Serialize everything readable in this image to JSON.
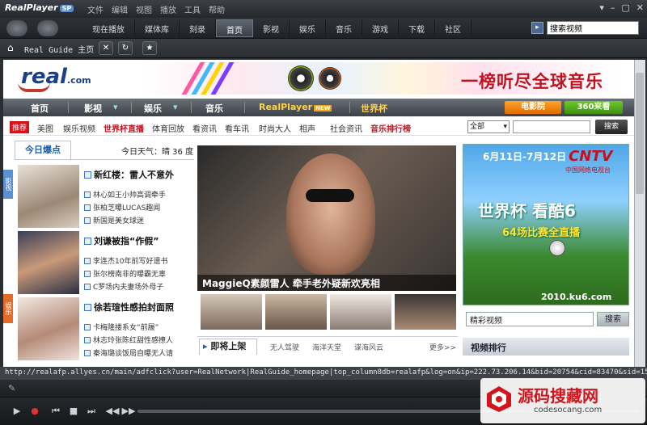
{
  "titlebar": {
    "logo": "RealPlayer",
    "logo_badge": "SP",
    "menu": [
      "文件",
      "编辑",
      "视图",
      "播放",
      "工具",
      "帮助"
    ],
    "window_buttons": [
      "▾",
      "–",
      "▢",
      "✕"
    ]
  },
  "nav": {
    "tabs": [
      "现在播放",
      "媒体库",
      "刻录",
      "首页",
      "影视",
      "娱乐",
      "音乐",
      "游戏",
      "下载",
      "社区"
    ],
    "active_tab": "首页",
    "search_value": "搜索视频"
  },
  "address": {
    "text": "Real Guide 主页",
    "buttons": [
      "✕",
      "↻",
      "★"
    ]
  },
  "site": {
    "logo": "real",
    "logo_suffix": ".com",
    "banner_text": "一榜听尽全球音乐",
    "channels": [
      "首页",
      "影视",
      "娱乐",
      "音乐",
      "RealPlayer",
      "世界杯"
    ],
    "realplayer_badge": "NEW",
    "btn_movie": "电影院",
    "btn_360": "360来看",
    "hot_badge": "推荐",
    "subnav": [
      "美图",
      "娱乐视频",
      "世界杯直播",
      "体育回放",
      "看资讯",
      "看车讯",
      "时尚大人",
      "相声",
      "社会资讯",
      "音乐排行榜"
    ],
    "subnav_select": "全部",
    "subnav_search_btn": "搜索",
    "today_tab": "今日爆点",
    "weather": "今日天气：晴 36 度",
    "side_tab_1": "影视",
    "side_tab_2": "娱乐",
    "news": [
      {
        "headline": "新红楼：雷人不意外",
        "links": [
          "林心如王小帅高调牵手",
          "张柏芝曝LUCAS趣闻",
          "新国是美女球迷"
        ]
      },
      {
        "headline": "刘谦被指“作假”",
        "links": [
          "李连杰10年前写好遗书",
          "张尔榜南非的曝霸无辜",
          "C罗场内夫妻场外母子"
        ]
      },
      {
        "headline": "徐若瑄性感拍封面照",
        "links": [
          "卡梅隆搂系女“前履”",
          "林志玲张陈红甜性感撩人",
          "秦海璐谈饭局自曝无人请"
        ]
      }
    ],
    "feature_caption": "MaggieQ素颜雷人 牵手老外疑新欢亮相",
    "upcoming_tab": "即将上架",
    "upcoming_links": [
      "无人驾驶",
      "海洋天堂",
      "谍海风云"
    ],
    "upcoming_more": "更多>>",
    "ad": {
      "dates": "6月11日-7月12日",
      "brand": "CNTV",
      "brand_sub": "中国网络电视台",
      "slogan": "世界杯 看酷6",
      "slogan2": "64场比赛全直播",
      "url": "2010.ku6.com"
    },
    "video_search_value": "精彩视频",
    "video_search_btn": "搜索",
    "rank_heading": "视频排行"
  },
  "status": {
    "url": "http://realafp.allyes.cn/main/adfclick?user=RealNetwork|RealGuide_homepage|top_column8db=realafp&log=on&ip=222.73.206.14&bid=20754&cid=83470&sid=15634"
  },
  "player": {
    "buttons": [
      "▶",
      "●",
      "⏮",
      "■",
      "⏭",
      "◀◀",
      "▶▶"
    ]
  },
  "watermark": {
    "title": "源码搜藏网",
    "url": "codesocang.com"
  },
  "colors": {
    "chrome": "#2b2e33",
    "accent_red": "#c1121f",
    "link_blue": "#1c5fa8"
  }
}
